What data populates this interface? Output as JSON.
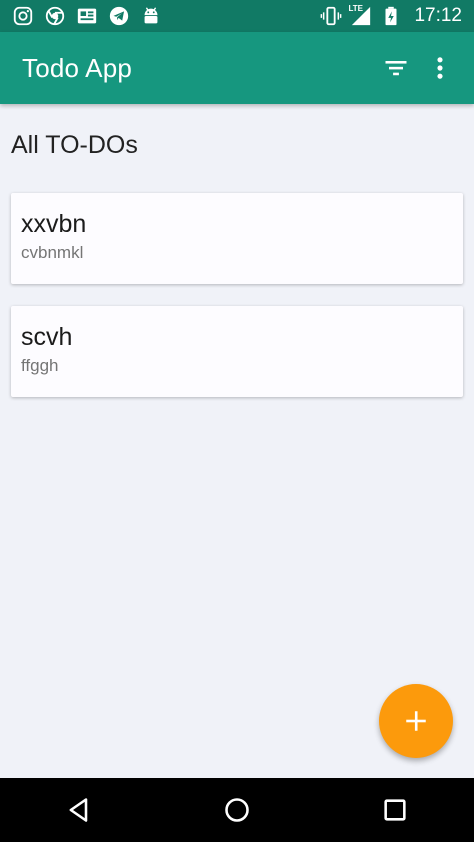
{
  "status_bar": {
    "time": "17:12",
    "network_label": "LTE",
    "left_icons": [
      "instagram-icon",
      "chrome-icon",
      "news-icon",
      "telegram-icon",
      "android-icon"
    ],
    "right_icons": [
      "vibrate-icon",
      "signal-icon",
      "battery-icon"
    ]
  },
  "app_bar": {
    "title": "Todo App",
    "actions": [
      "filter-icon",
      "more-vert-icon"
    ]
  },
  "main": {
    "section_title": "All TO-DOs",
    "todos": [
      {
        "title": "xxvbn",
        "description": "cvbnmkl"
      },
      {
        "title": "scvh",
        "description": "ffggh"
      }
    ]
  },
  "fab": {
    "icon": "add-icon"
  },
  "nav_bar": {
    "buttons": [
      "back-icon",
      "home-icon",
      "recents-icon"
    ]
  },
  "colors": {
    "status_bar": "#117a65",
    "app_bar": "#16977f",
    "fab": "#fc9a0c",
    "background": "#f0f2f8"
  }
}
